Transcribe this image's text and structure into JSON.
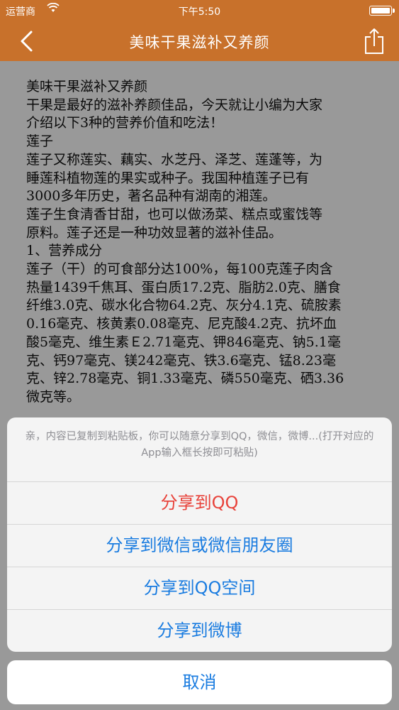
{
  "status_bar": {
    "carrier": "运营商",
    "time": "下午5:50"
  },
  "nav": {
    "title": "美味干果滋补又养颜",
    "back_icon": "chevron-left-icon",
    "share_icon": "share-icon"
  },
  "article": {
    "lines": [
      "美味干果滋补又养颜",
      "干果是最好的滋补养颜佳品，今天就让小编为大家",
      "介绍以下3种的营养价值和吃法！",
      "莲子",
      "莲子又称莲实、藕实、水芝丹、泽芝、莲蓬等，为",
      "睡莲科植物莲的果实或种子。我国种植莲子已有",
      "3000多年历史，著名品种有湖南的湘莲。",
      "莲子生食清香甘甜，也可以做汤菜、糕点或蜜饯等",
      "原料。莲子还是一种功效显著的滋补佳品。",
      "1、营养成分",
      "莲子（干）的可食部分达100%，每100克莲子肉含",
      "热量1439千焦耳、蛋白质17.2克、脂肪2.0克、膳食",
      "纤维3.0克、碳水化合物64.2克、灰分4.1克、硫胺素",
      "0.16毫克、核黄素0.08毫克、尼克酸4.2克、抗坏血",
      "酸5毫克、维生素Ｅ2.71毫克、钾846毫克、钠5.1毫",
      "克、钙97毫克、镁242毫克、铁3.6毫克、锰8.23毫",
      "克、锌2.78毫克、铜1.33毫克、磷550毫克、硒3.36",
      "微克等。"
    ]
  },
  "action_sheet": {
    "message": "亲，内容已复制到粘贴板，你可以随意分享到QQ，微信，微博...(打开对应的App输入框长按即可粘贴)",
    "share_qq": "分享到QQ",
    "share_wechat": "分享到微信或微信朋友圈",
    "share_qzone": "分享到QQ空间",
    "share_weibo": "分享到微博",
    "cancel": "取消"
  },
  "colors": {
    "nav_background": "#c8712b",
    "action_blue": "#1a7ce0",
    "action_red": "#e8423a"
  }
}
